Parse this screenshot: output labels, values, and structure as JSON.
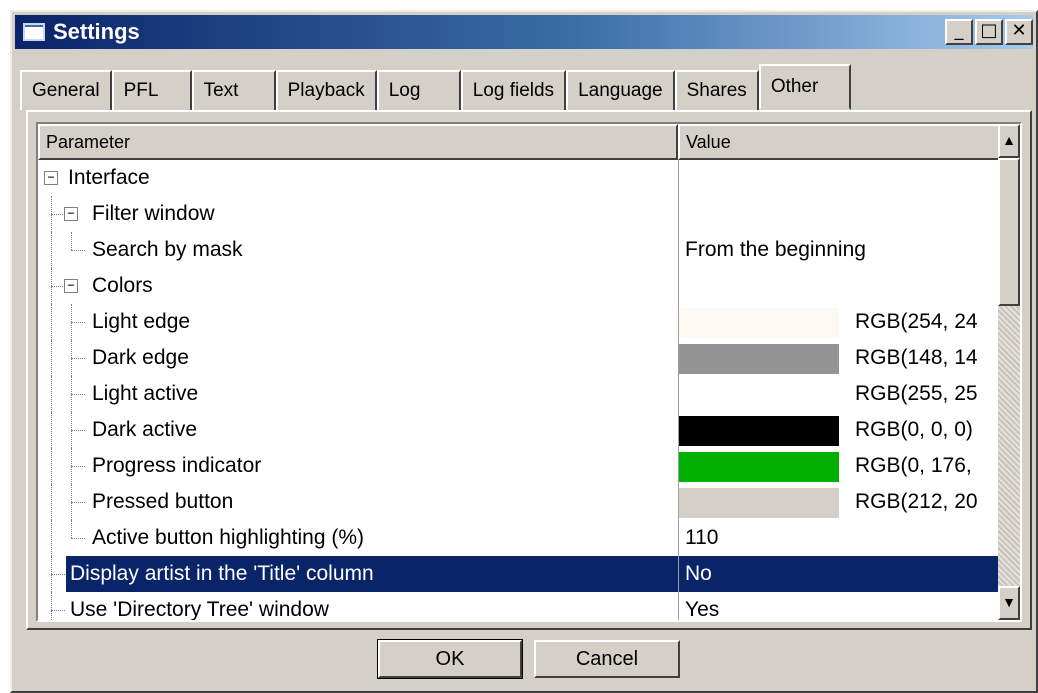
{
  "window": {
    "title": "Settings",
    "buttons": {
      "minimize": "_",
      "maximize": "□",
      "close": "✕"
    }
  },
  "tabs": [
    {
      "label": "General",
      "active": false
    },
    {
      "label": "PFL",
      "active": false
    },
    {
      "label": "Text",
      "active": false
    },
    {
      "label": "Playback",
      "active": false
    },
    {
      "label": "Log",
      "active": false
    },
    {
      "label": "Log fields",
      "active": false
    },
    {
      "label": "Language",
      "active": false
    },
    {
      "label": "Shares",
      "active": false
    },
    {
      "label": "Other",
      "active": true
    }
  ],
  "grid": {
    "columns": {
      "parameter": "Parameter",
      "value": "Value"
    },
    "rows": [
      {
        "label": "Interface",
        "value": "",
        "level": 0,
        "expander": "−"
      },
      {
        "label": "Filter window",
        "value": "",
        "level": 1,
        "expander": "−"
      },
      {
        "label": "Search by mask",
        "value": "From the beginning",
        "level": 2
      },
      {
        "label": "Colors",
        "value": "",
        "level": 1,
        "expander": "−"
      },
      {
        "label": "Light edge",
        "value": "RGB(254, 24",
        "level": 2,
        "swatch": "#fef8f2"
      },
      {
        "label": "Dark edge",
        "value": "RGB(148, 14",
        "level": 2,
        "swatch": "#949494"
      },
      {
        "label": "Light active",
        "value": "RGB(255, 25",
        "level": 2,
        "swatch": "#ffffff"
      },
      {
        "label": "Dark active",
        "value": "RGB(0, 0, 0)",
        "level": 2,
        "swatch": "#000000"
      },
      {
        "label": "Progress indicator",
        "value": "RGB(0, 176,",
        "level": 2,
        "swatch": "#00b000"
      },
      {
        "label": "Pressed button",
        "value": "RGB(212, 20",
        "level": 2,
        "swatch": "#d4d0c8"
      },
      {
        "label": "Active button highlighting (%)",
        "value": "110",
        "level": 2
      },
      {
        "label": "Display artist in the 'Title' column",
        "value": "No",
        "level": 1,
        "selected": true
      },
      {
        "label": "Use 'Directory Tree' window",
        "value": "Yes",
        "level": 1
      }
    ],
    "scroll": {
      "up": "▲",
      "down": "▼"
    }
  },
  "footer": {
    "ok": "OK",
    "cancel": "Cancel"
  }
}
